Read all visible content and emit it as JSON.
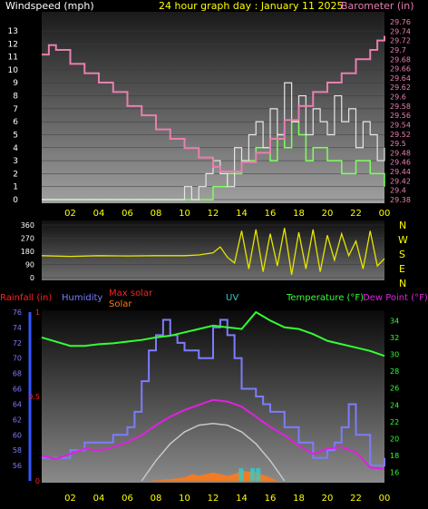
{
  "colors": {
    "wind": "#e6e6e6",
    "gust": "#7cff5a",
    "baro": "#e87fb0",
    "dir": "#e6e600",
    "humidity": "#7c7cff",
    "temperature": "#33ff33",
    "dewpoint": "#e020e0",
    "rain": "#ff2020",
    "maxsolar": "#c8c8c8",
    "solar": "#ff7a1a",
    "uv": "#33cccc",
    "yellowText": "#ffff00",
    "whiteText": "#ffffff"
  },
  "header": {
    "windspeed_label": "Windspeed (mph)",
    "title": "24 hour graph day : January 11 2025",
    "barometer_label": "Barometer (in)"
  },
  "bottom_header": {
    "rainfall": "Rainfall (in)",
    "humidity": "Humidity",
    "maxsolar": "Max solar",
    "solar": "Solar",
    "uv": "UV",
    "temperature": "Temperature (°F)",
    "dewpoint": "Dew Point (°F)"
  },
  "compass": [
    "N",
    "W",
    "S",
    "E",
    "N"
  ],
  "chart_data": [
    {
      "type": "line",
      "title": "24 hour graph day : January 11 2025",
      "ylabel": "Windspeed (mph)",
      "y2label": "Barometer (in)",
      "x_ticks": [
        "02",
        "04",
        "06",
        "08",
        "10",
        "12",
        "14",
        "16",
        "18",
        "20",
        "22",
        "00"
      ],
      "ylim": [
        0,
        13.7
      ],
      "y_ticks": [
        0,
        1,
        2,
        3,
        4,
        5,
        6,
        7,
        8,
        9,
        10,
        11,
        12,
        13
      ],
      "y2lim": [
        29.38,
        29.76
      ],
      "y2_ticks": [
        "29.38",
        "29.4",
        "29.42",
        "29.44",
        "29.46",
        "29.48",
        "29.5",
        "29.52",
        "29.54",
        "29.56",
        "29.58",
        "29.6",
        "29.62",
        "29.64",
        "29.66",
        "29.68",
        "29.7",
        "29.72",
        "29.74",
        "29.76"
      ],
      "series": [
        {
          "name": "Windspeed",
          "axis": "left",
          "x": [
            0,
            2,
            4,
            6,
            8,
            9.5,
            10,
            10.5,
            11,
            11.5,
            12,
            12.5,
            13,
            13.5,
            14,
            14.5,
            15,
            15.5,
            16,
            16.5,
            17,
            17.5,
            18,
            18.5,
            19,
            19.5,
            20,
            20.5,
            21,
            21.5,
            22,
            22.5,
            23,
            23.5,
            24
          ],
          "y": [
            0,
            0,
            0,
            0,
            0,
            0,
            1,
            0,
            1,
            2,
            3,
            2,
            1,
            4,
            3,
            5,
            6,
            4,
            7,
            5,
            9,
            6,
            8,
            5,
            7,
            6,
            5,
            8,
            6,
            7,
            4,
            6,
            5,
            3,
            4
          ]
        },
        {
          "name": "Gust",
          "axis": "left",
          "x": [
            0,
            2,
            4,
            6,
            8,
            10,
            12,
            13,
            14,
            15,
            16,
            16.5,
            17,
            17.5,
            18,
            18.5,
            19,
            20,
            21,
            22,
            23,
            24
          ],
          "y": [
            0,
            0,
            0,
            0,
            0,
            0,
            1,
            2,
            3,
            4,
            3,
            5,
            4,
            6,
            5,
            3,
            4,
            3,
            2,
            3,
            2,
            1
          ]
        },
        {
          "name": "Barometer",
          "axis": "right",
          "x": [
            0,
            0.5,
            1,
            2,
            3,
            4,
            5,
            6,
            7,
            8,
            9,
            10,
            11,
            12,
            12.5,
            13,
            14,
            15,
            16,
            17,
            18,
            19,
            20,
            21,
            22,
            23,
            23.5,
            24
          ],
          "y": [
            29.69,
            29.71,
            29.7,
            29.67,
            29.65,
            29.63,
            29.61,
            29.58,
            29.56,
            29.53,
            29.51,
            29.49,
            29.47,
            29.45,
            29.44,
            29.44,
            29.46,
            29.48,
            29.51,
            29.55,
            29.58,
            29.61,
            29.63,
            29.65,
            29.68,
            29.7,
            29.72,
            29.73
          ]
        }
      ]
    },
    {
      "type": "line",
      "ylabel": "Wind direction",
      "ylim": [
        0,
        360
      ],
      "y_ticks": [
        0,
        90,
        180,
        270,
        360
      ],
      "series": [
        {
          "name": "Direction",
          "x": [
            0,
            2,
            4,
            6,
            8,
            10,
            11,
            12,
            12.5,
            13,
            13.5,
            14,
            14.5,
            15,
            15.5,
            16,
            16.5,
            17,
            17.5,
            18,
            18.5,
            19,
            19.5,
            20,
            20.5,
            21,
            21.5,
            22,
            22.5,
            23,
            23.5,
            24
          ],
          "y": [
            150,
            145,
            150,
            148,
            150,
            150,
            155,
            170,
            210,
            140,
            100,
            320,
            60,
            330,
            40,
            300,
            80,
            340,
            20,
            310,
            60,
            330,
            40,
            290,
            120,
            300,
            150,
            250,
            60,
            320,
            80,
            130
          ]
        }
      ]
    },
    {
      "type": "line",
      "x_ticks": [
        "02",
        "04",
        "06",
        "08",
        "10",
        "12",
        "14",
        "16",
        "18",
        "20",
        "22",
        "00"
      ],
      "humidity_ylim": [
        54,
        76
      ],
      "humidity_ticks": [
        56,
        58,
        60,
        62,
        64,
        66,
        68,
        70,
        72,
        74,
        76
      ],
      "temp_ylim": [
        15,
        35
      ],
      "temp_ticks": [
        16,
        18,
        20,
        22,
        24,
        26,
        28,
        30,
        32,
        34
      ],
      "rain_ylim": [
        0,
        1
      ],
      "rain_ticks": [
        "0",
        "0.5",
        "1"
      ],
      "series": [
        {
          "name": "Humidity",
          "axis": "left",
          "x": [
            0,
            1,
            2,
            3,
            4,
            5,
            6,
            6.5,
            7,
            7.5,
            8,
            8.5,
            9,
            9.5,
            10,
            11,
            12,
            12.5,
            13,
            13.5,
            14,
            15,
            15.5,
            16,
            17,
            18,
            19,
            19.5,
            20,
            20.5,
            21,
            21.5,
            22,
            23,
            24
          ],
          "y": [
            57,
            57,
            58,
            59,
            59,
            60,
            61,
            63,
            67,
            71,
            73,
            75,
            73,
            72,
            71,
            70,
            74,
            75,
            73,
            70,
            66,
            65,
            64,
            63,
            61,
            59,
            57,
            57,
            58,
            59,
            61,
            64,
            60,
            56,
            57
          ]
        },
        {
          "name": "Temperature",
          "axis": "right",
          "x": [
            0,
            1,
            2,
            3,
            4,
            5,
            6,
            7,
            8,
            9,
            10,
            11,
            12,
            13,
            14,
            14.5,
            15,
            15.5,
            16,
            17,
            18,
            19,
            20,
            21,
            22,
            23,
            24
          ],
          "y": [
            32,
            31.5,
            31,
            31,
            31.2,
            31.3,
            31.5,
            31.7,
            32,
            32.2,
            32.6,
            33,
            33.4,
            33.2,
            33,
            34,
            35,
            34.5,
            34,
            33.2,
            33,
            32.4,
            31.6,
            31.2,
            30.8,
            30.4,
            29.8
          ]
        },
        {
          "name": "Dew Point",
          "axis": "right",
          "x": [
            0,
            1,
            2,
            3,
            4,
            5,
            6,
            7,
            8,
            9,
            10,
            11,
            12,
            13,
            14,
            15,
            16,
            17,
            18,
            19,
            20,
            21,
            22,
            23,
            24
          ],
          "y": [
            18,
            17.6,
            18.2,
            18.8,
            18.6,
            19,
            19.6,
            20.4,
            21.6,
            22.6,
            23.4,
            24,
            24.6,
            24.4,
            23.8,
            22.6,
            21.4,
            20.4,
            19.2,
            18.2,
            18.8,
            19,
            18.4,
            16.6,
            16.4
          ]
        },
        {
          "name": "Max solar",
          "axis": "rain",
          "x": [
            7,
            8,
            9,
            10,
            11,
            12,
            13,
            14,
            15,
            16,
            17
          ],
          "y": [
            0,
            0.12,
            0.22,
            0.29,
            0.33,
            0.34,
            0.33,
            0.29,
            0.22,
            0.12,
            0
          ]
        },
        {
          "name": "Solar",
          "axis": "rain",
          "x": [
            7.5,
            9,
            10,
            10.5,
            11,
            12,
            13,
            13.5,
            14,
            15,
            16,
            16.5
          ],
          "y": [
            0,
            0.01,
            0.02,
            0.04,
            0.03,
            0.05,
            0.03,
            0.04,
            0.06,
            0.05,
            0.02,
            0
          ]
        }
      ]
    }
  ]
}
